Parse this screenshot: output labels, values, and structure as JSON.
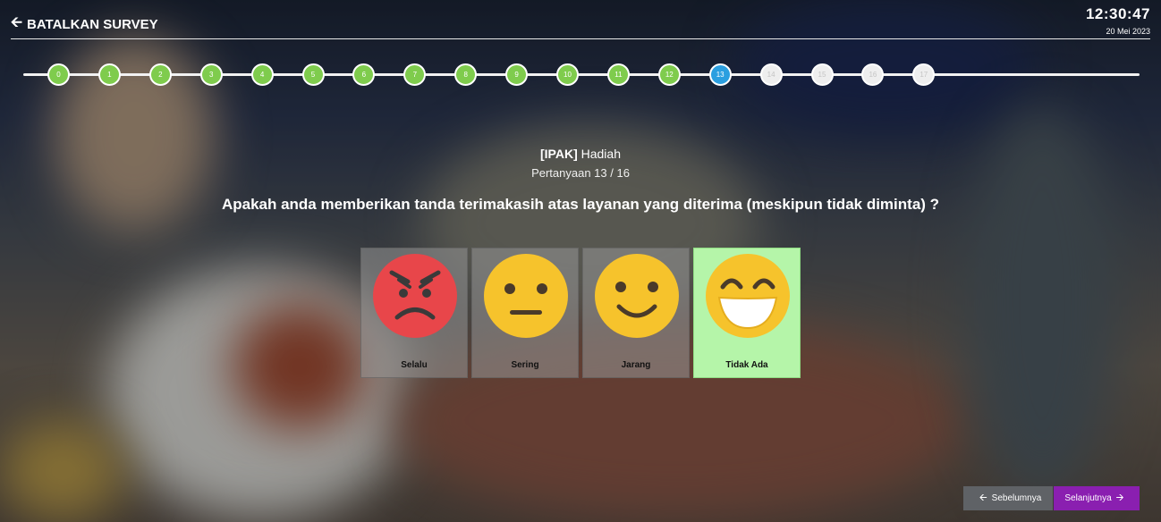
{
  "header": {
    "back_label": "BATALKAN SURVEY",
    "back_icon": "arrow-left-icon",
    "time": "12:30:47",
    "date": "20 Mei 2023"
  },
  "progress": {
    "steps": [
      "0",
      "1",
      "2",
      "3",
      "4",
      "5",
      "6",
      "7",
      "8",
      "9",
      "10",
      "11",
      "12",
      "13",
      "14",
      "15",
      "16",
      "17"
    ],
    "current_index": 13,
    "colors": {
      "done": "#7fcc4d",
      "current": "#2b9fe0",
      "todo": "#eeeeee"
    }
  },
  "question": {
    "category_code": "[IPAK]",
    "category_name": "Hadiah",
    "counter": "Pertanyaan 13 / 16",
    "text": "Apakah anda memberikan tanda terimakasih atas layanan yang diterima (meskipun tidak diminta) ?"
  },
  "options": [
    {
      "label": "Selalu",
      "icon": "angry-face-icon",
      "selected": false
    },
    {
      "label": "Sering",
      "icon": "neutral-face-icon",
      "selected": false
    },
    {
      "label": "Jarang",
      "icon": "smiling-face-icon",
      "selected": false
    },
    {
      "label": "Tidak Ada",
      "icon": "grinning-face-icon",
      "selected": true
    }
  ],
  "nav": {
    "prev_label": "Sebelumnya",
    "next_label": "Selanjutnya",
    "prev_color": "#5f6266",
    "next_color": "#8a1fb0"
  }
}
